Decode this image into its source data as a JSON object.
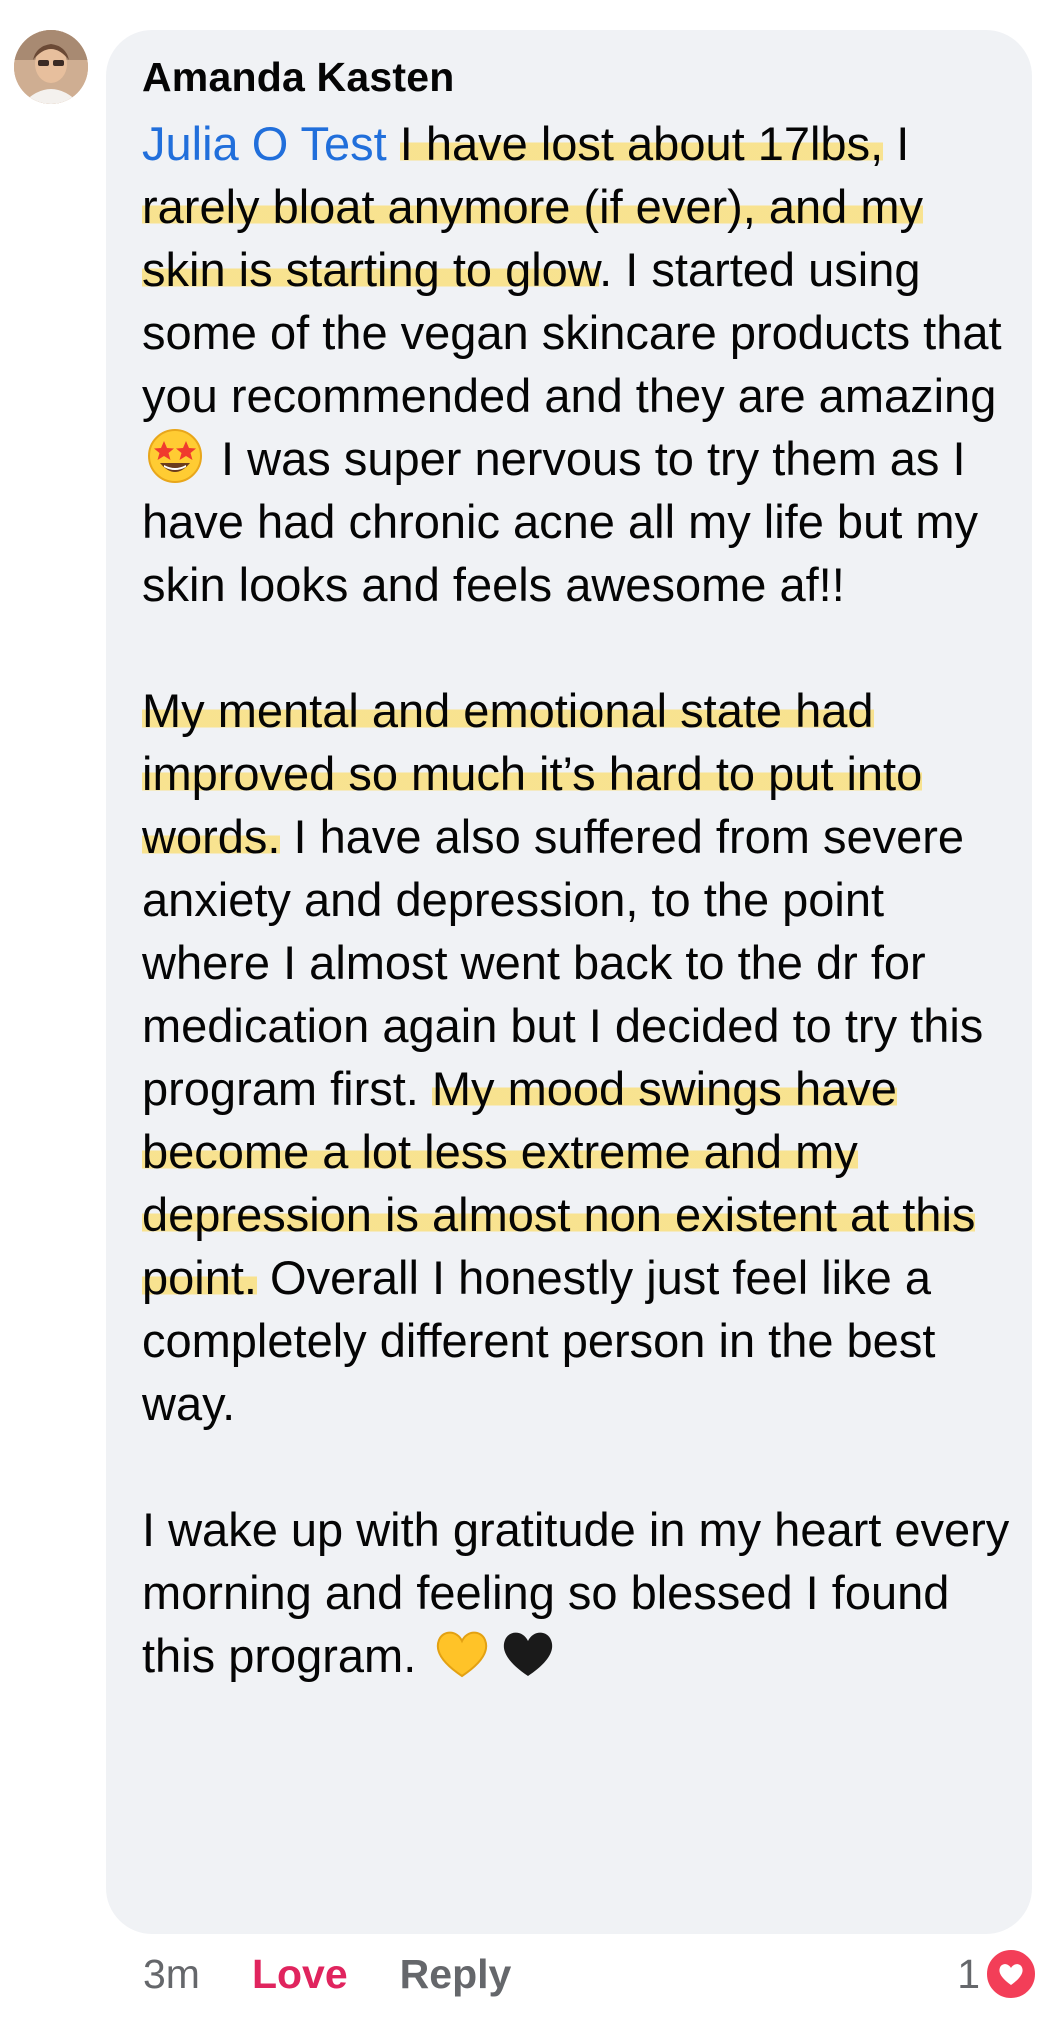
{
  "comment": {
    "author": "Amanda Kasten",
    "mention": "Julia O Test",
    "p1_a": " ",
    "p1_hl1": "I have lost about 17lbs,",
    "p1_b": " I ",
    "p1_hl2": "rarely bloat anymore (if ever), and my skin is starting to glow",
    "p1_c": ". I started using some of the vegan skincare products that you recommended and they are amazing ",
    "p1_d": " I was super nervous to try them as I have had chronic acne all my life but my skin looks and feels awesome af!!",
    "p2_hl1": "My mental and emotional state had improved so much it’s hard to put into words.",
    "p2_a": " I have also suffered from severe anxiety and depression, to the point where I almost went back to the dr for medication again but I decided to try this program first. ",
    "p2_hl2": "My mood swings have become a lot less extreme and my depression",
    "p2_b": " is almost non existent at this point.",
    "p2_c": " Overall I honestly just feel like a completely different person in the best way.",
    "p3_a": "I wake up with gratitude in my heart every morning and feeling so blessed I found this program. ",
    "emojis": [
      "star-struck-emoji",
      "yellow-heart-emoji",
      "black-heart-emoji"
    ],
    "highlight_color": "#ffd63c"
  },
  "actions": {
    "time": "3m",
    "love_label": "Love",
    "reply_label": "Reply"
  },
  "reactions": {
    "count": "1",
    "type": "love",
    "badge_color": "#f33e58"
  },
  "colors": {
    "bubble": "#f0f2f5",
    "mention": "#216fdb",
    "love": "#e0245e",
    "muted": "#65676b"
  }
}
